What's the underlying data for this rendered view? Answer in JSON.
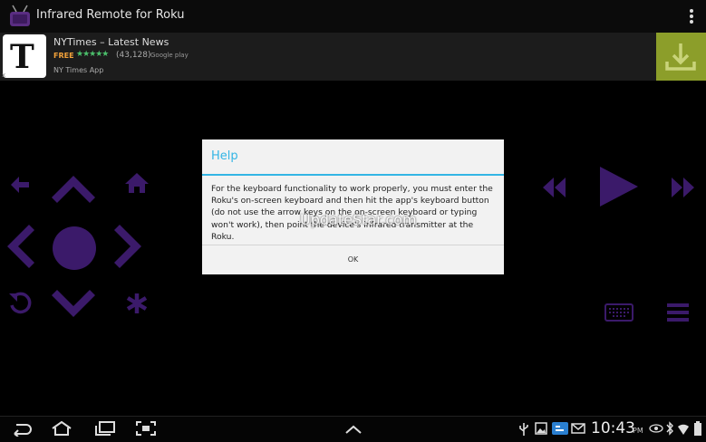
{
  "app": {
    "title": "Infrared Remote for Roku",
    "icon": "tv-icon"
  },
  "ad": {
    "title": "NYTimes – Latest News",
    "price": "FREE",
    "stars": "★★★★★",
    "rating_count": "(43,128)",
    "store": "Google play",
    "publisher": "NY Times App",
    "logo_letter": "T",
    "close_label": "x",
    "download_color": "#8c9e2a"
  },
  "dialog": {
    "title": "Help",
    "message": "For the keyboard functionality to work properly, you must enter the Roku's on-screen keyboard and then hit the app's keyboard button (do not use the arrow keys on the on-screen keyboard or typing won't work), then point the device's infrared transmitter at the Roku.",
    "ok_label": "OK"
  },
  "watermark": "UpdateStar.com",
  "status": {
    "time": "10:43",
    "ampm": "PM"
  },
  "colors": {
    "accent": "#33b5e5",
    "control": "#3b1a6a"
  }
}
